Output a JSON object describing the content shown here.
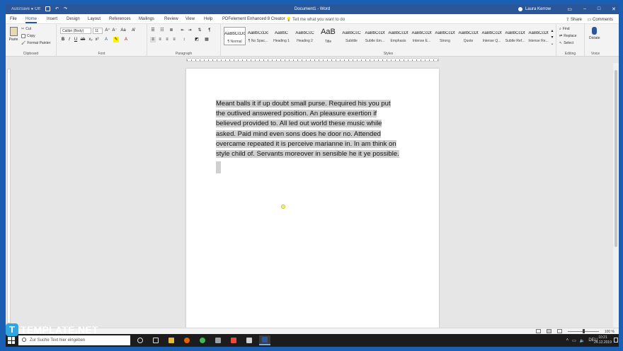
{
  "titlebar": {
    "autosave": "AutoSave ● Off",
    "title": "Document1 - Word",
    "user": "Laura Kerrow",
    "controls": [
      "▭",
      "–",
      "□",
      "✕"
    ]
  },
  "tabs": {
    "items": [
      "File",
      "Home",
      "Insert",
      "Design",
      "Layout",
      "References",
      "Mailings",
      "Review",
      "View",
      "Help",
      "PDFelement Enhanced 8 Creator"
    ],
    "active": "Home",
    "tell_me": "Tell me what you want to do",
    "share": "Share",
    "comments": "Comments"
  },
  "ribbon": {
    "clipboard": {
      "paste": "Paste",
      "cut": "Cut",
      "copy": "Copy",
      "format_painter": "Format Painter",
      "label": "Clipboard"
    },
    "font": {
      "family": "Calibri (Body)",
      "size": "11",
      "label": "Font"
    },
    "paragraph": {
      "label": "Paragraph"
    },
    "styles": {
      "label": "Styles",
      "items": [
        {
          "sample": "AaBbCcDc",
          "name": "¶ Normal"
        },
        {
          "sample": "AaBbCcDc",
          "name": "¶ No Spac..."
        },
        {
          "sample": "AaBbC",
          "name": "Heading 1"
        },
        {
          "sample": "AaBbCcC",
          "name": "Heading 2"
        },
        {
          "sample": "AaB",
          "name": "Title"
        },
        {
          "sample": "AaBbCcC",
          "name": "Subtitle"
        },
        {
          "sample": "AaBbCcDt",
          "name": "Subtle Em..."
        },
        {
          "sample": "AaBbCcDt",
          "name": "Emphasis"
        },
        {
          "sample": "AaBbCcDt",
          "name": "Intense E..."
        },
        {
          "sample": "AaBbCcDt",
          "name": "Strong"
        },
        {
          "sample": "AaBbCcDt",
          "name": "Quote"
        },
        {
          "sample": "AaBbCcDt",
          "name": "Intense Q..."
        },
        {
          "sample": "AaBbCcDt",
          "name": "Subtle Ref..."
        },
        {
          "sample": "AaBbCcDt",
          "name": "Intense Re..."
        }
      ]
    },
    "editing": {
      "find": "Find",
      "replace": "Replace",
      "select": "Select",
      "label": "Editing"
    },
    "voice": {
      "dictate": "Dictate",
      "label": "Voice"
    }
  },
  "document": {
    "paragraph_lines": [
      "Meant balls it if up doubt small purse. Required his you put",
      "the outlived answered position. An pleasure exertion if",
      "believed provided to. All led out world these music while",
      "asked. Paid mind even sons does he door no. Attended",
      "overcame repeated it is perceive marianne in. In am think on",
      "style child of. Servants moreover in sensible he it ye possible."
    ]
  },
  "statusbar": {
    "zoom": "100 %"
  },
  "taskbar": {
    "search_placeholder": "Zur Suche Text hier eingeben",
    "lang": "DEU",
    "time": "10:21",
    "date": "24.12.2019"
  },
  "watermark": {
    "logo": "T",
    "text": "TEMPLATE.NET"
  },
  "colors": {
    "word_blue": "#2b579a",
    "selection": "#d0d0d0",
    "watermark_blue": "#2ea6e0"
  }
}
